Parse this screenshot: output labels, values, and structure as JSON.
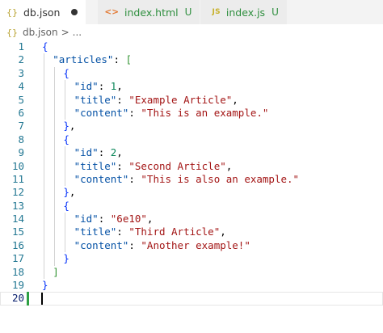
{
  "tabs": [
    {
      "icon": "{}",
      "name": "db.json",
      "status": "",
      "dirty": true,
      "active": true
    },
    {
      "icon": "<>",
      "name": "index.html",
      "status": "U",
      "dirty": false,
      "active": false
    },
    {
      "icon": "JS",
      "name": "index.js",
      "status": "U",
      "dirty": false,
      "active": false
    }
  ],
  "breadcrumb": {
    "icon": "{}",
    "file": "db.json",
    "separator": ">",
    "more": "..."
  },
  "editor": {
    "current_line": 20,
    "lines": [
      {
        "n": "1",
        "indent": 0,
        "tokens": [
          [
            "brace",
            "{"
          ]
        ]
      },
      {
        "n": "2",
        "indent": 1,
        "tokens": [
          [
            "key",
            "\"articles\""
          ],
          [
            "punc",
            ": "
          ],
          [
            "bracket",
            "["
          ]
        ]
      },
      {
        "n": "3",
        "indent": 2,
        "tokens": [
          [
            "brace",
            "{"
          ]
        ]
      },
      {
        "n": "4",
        "indent": 3,
        "tokens": [
          [
            "key",
            "\"id\""
          ],
          [
            "punc",
            ": "
          ],
          [
            "num",
            "1"
          ],
          [
            "punc",
            ","
          ]
        ]
      },
      {
        "n": "5",
        "indent": 3,
        "tokens": [
          [
            "key",
            "\"title\""
          ],
          [
            "punc",
            ": "
          ],
          [
            "str",
            "\"Example Article\""
          ],
          [
            "punc",
            ","
          ]
        ]
      },
      {
        "n": "6",
        "indent": 3,
        "tokens": [
          [
            "key",
            "\"content\""
          ],
          [
            "punc",
            ": "
          ],
          [
            "str",
            "\"This is an example.\""
          ]
        ]
      },
      {
        "n": "7",
        "indent": 2,
        "tokens": [
          [
            "brace",
            "}"
          ],
          [
            "punc",
            ","
          ]
        ]
      },
      {
        "n": "8",
        "indent": 2,
        "tokens": [
          [
            "brace",
            "{"
          ]
        ]
      },
      {
        "n": "9",
        "indent": 3,
        "tokens": [
          [
            "key",
            "\"id\""
          ],
          [
            "punc",
            ": "
          ],
          [
            "num",
            "2"
          ],
          [
            "punc",
            ","
          ]
        ]
      },
      {
        "n": "10",
        "indent": 3,
        "tokens": [
          [
            "key",
            "\"title\""
          ],
          [
            "punc",
            ": "
          ],
          [
            "str",
            "\"Second Article\""
          ],
          [
            "punc",
            ","
          ]
        ]
      },
      {
        "n": "11",
        "indent": 3,
        "tokens": [
          [
            "key",
            "\"content\""
          ],
          [
            "punc",
            ": "
          ],
          [
            "str",
            "\"This is also an example.\""
          ]
        ]
      },
      {
        "n": "12",
        "indent": 2,
        "tokens": [
          [
            "brace",
            "}"
          ],
          [
            "punc",
            ","
          ]
        ]
      },
      {
        "n": "13",
        "indent": 2,
        "tokens": [
          [
            "brace",
            "{"
          ]
        ]
      },
      {
        "n": "14",
        "indent": 3,
        "tokens": [
          [
            "key",
            "\"id\""
          ],
          [
            "punc",
            ": "
          ],
          [
            "str",
            "\"6e10\""
          ],
          [
            "punc",
            ","
          ]
        ]
      },
      {
        "n": "15",
        "indent": 3,
        "tokens": [
          [
            "key",
            "\"title\""
          ],
          [
            "punc",
            ": "
          ],
          [
            "str",
            "\"Third Article\""
          ],
          [
            "punc",
            ","
          ]
        ]
      },
      {
        "n": "16",
        "indent": 3,
        "tokens": [
          [
            "key",
            "\"content\""
          ],
          [
            "punc",
            ": "
          ],
          [
            "str",
            "\"Another example!\""
          ]
        ]
      },
      {
        "n": "17",
        "indent": 2,
        "tokens": [
          [
            "brace",
            "}"
          ]
        ]
      },
      {
        "n": "18",
        "indent": 1,
        "tokens": [
          [
            "bracket",
            "]"
          ]
        ]
      },
      {
        "n": "19",
        "indent": 0,
        "tokens": [
          [
            "brace",
            "}"
          ]
        ]
      },
      {
        "n": "20",
        "indent": 0,
        "tokens": []
      }
    ]
  },
  "colors": {
    "brace": "#0431fa",
    "bracket": "#319331",
    "key": "#0451a5",
    "string": "#a31515",
    "number": "#098658",
    "line_number": "#237893",
    "untracked": "#2f8f3f"
  }
}
